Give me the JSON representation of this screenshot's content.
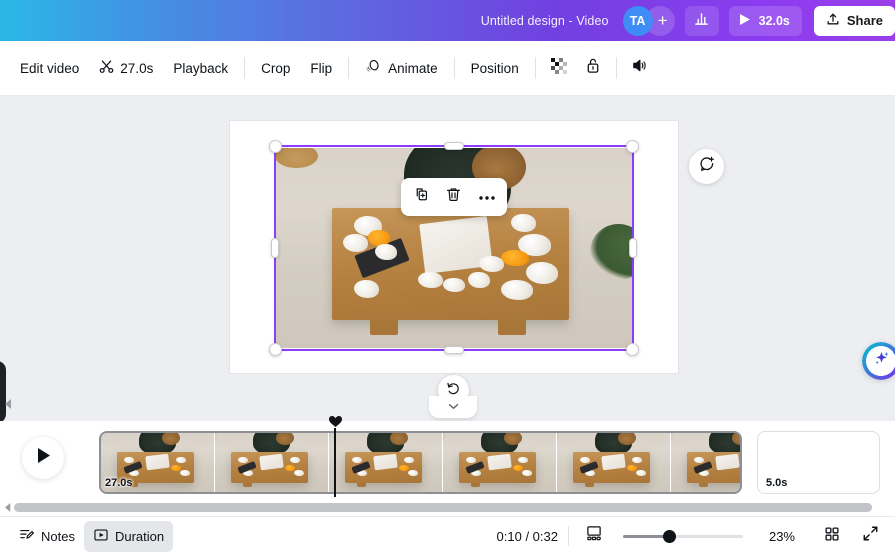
{
  "topbar": {
    "title": "Untitled design - Video",
    "avatar_initials": "TA",
    "add_collaborator_label": "+",
    "analytics_icon": "bar-chart-icon",
    "play_icon": "play-icon",
    "total_duration": "32.0s",
    "share_label": "Share",
    "upload_icon": "upload-icon",
    "accent_blue": "#2bb8e6",
    "accent_purple": "#9a3fe8",
    "avatar_color": "#3e8cf5"
  },
  "toolbar": {
    "items": [
      {
        "label": "Edit video",
        "icon": null,
        "name": "edit-video-button"
      },
      {
        "label": "27.0s",
        "icon": "scissors-icon",
        "name": "trim-duration-button"
      },
      {
        "label": "Playback",
        "icon": null,
        "name": "playback-button"
      },
      {
        "label": "Crop",
        "icon": null,
        "name": "crop-button"
      },
      {
        "label": "Flip",
        "icon": null,
        "name": "flip-button"
      },
      {
        "label": "Animate",
        "icon": "animate-icon",
        "name": "animate-button"
      },
      {
        "label": "Position",
        "icon": null,
        "name": "position-button"
      }
    ],
    "icon_buttons": [
      {
        "icon": "transparency-icon",
        "name": "transparency-button"
      },
      {
        "icon": "unlock-icon",
        "name": "lock-button"
      },
      {
        "icon": "volume-icon",
        "name": "volume-button"
      }
    ]
  },
  "canvas": {
    "selection_color": "#8b3dfb",
    "float_toolbar": [
      {
        "icon": "duplicate-icon",
        "name": "duplicate-button"
      },
      {
        "icon": "trash-icon",
        "name": "delete-button"
      },
      {
        "icon": "more-options-icon",
        "name": "more-options-button"
      }
    ],
    "rotate_icon": "rotate-icon",
    "collapse_icon": "chevron-down-icon",
    "comment_icon": "add-comment-icon",
    "magic_icon": "magic-sparkle-icon",
    "side_panel_toggle": "panel-toggle-handle",
    "scroll_left_icon": "chevron-left-icon"
  },
  "timeline": {
    "play_icon": "play-icon",
    "selected_clip": {
      "duration_label": "27.0s",
      "thumbnail_count": 6
    },
    "empty_clip": {
      "duration_label": "5.0s"
    },
    "playhead_marker": "playhead-marker",
    "scroll_left_icon": "chevron-left-icon"
  },
  "bottombar": {
    "notes_label": "Notes",
    "notes_icon": "notes-icon",
    "duration_label": "Duration",
    "duration_icon": "duration-icon",
    "duration_active": true,
    "time_display": "0:10 / 0:32",
    "screen_icon": "presentation-icon",
    "zoom_level": "23%",
    "grid_icon": "grid-view-icon",
    "fullscreen_icon": "expand-icon"
  }
}
